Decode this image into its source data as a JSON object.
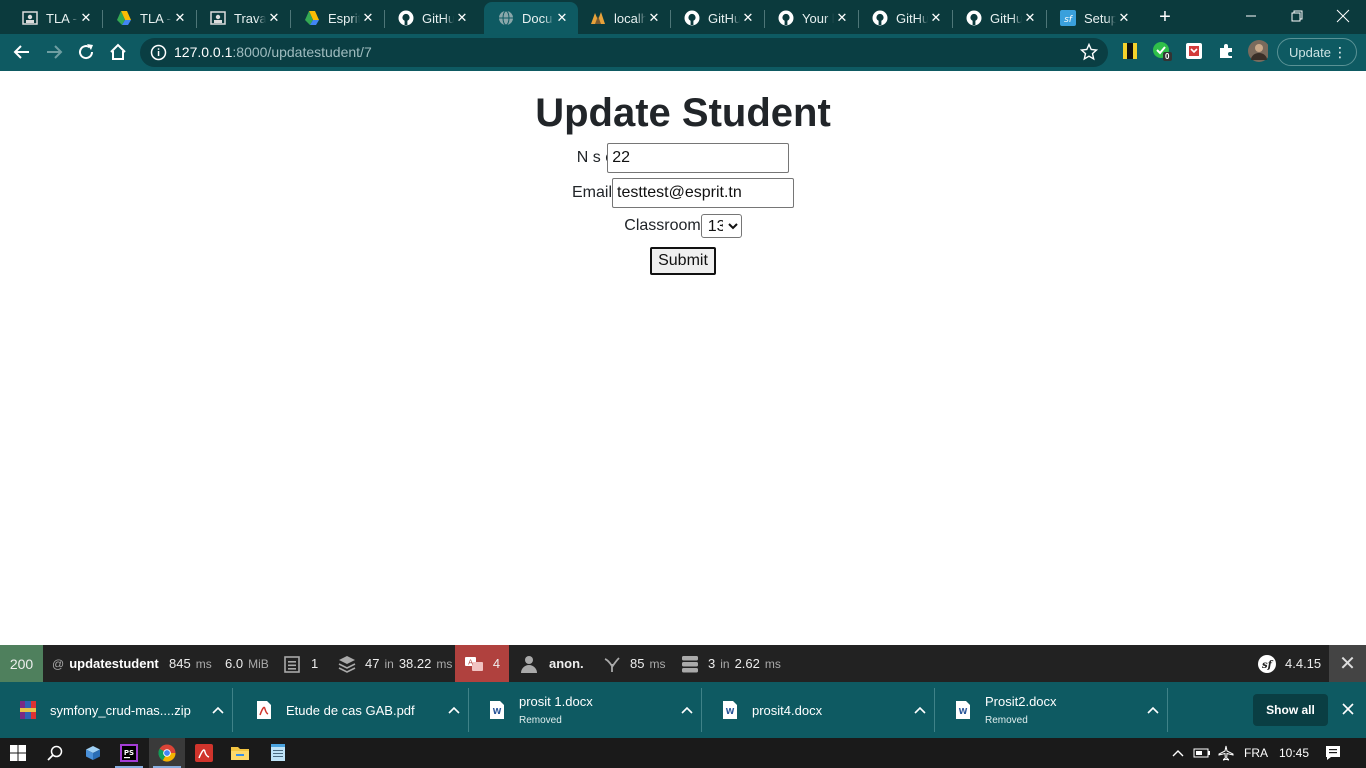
{
  "browser": {
    "tabs": [
      {
        "title": "TLA -",
        "icon": "person-board-icon"
      },
      {
        "title": "TLA -",
        "icon": "google-drive-icon"
      },
      {
        "title": "Travai",
        "icon": "person-board-icon"
      },
      {
        "title": "Esprit",
        "icon": "google-drive-icon"
      },
      {
        "title": "GitHu",
        "icon": "github-icon"
      },
      {
        "title": "Docu",
        "icon": "globe-icon",
        "active": true
      },
      {
        "title": "localh",
        "icon": "phpmyadmin-icon"
      },
      {
        "title": "GitHu",
        "icon": "github-icon"
      },
      {
        "title": "Your l",
        "icon": "github-icon"
      },
      {
        "title": "GitHu",
        "icon": "github-icon"
      },
      {
        "title": "GitHu",
        "icon": "github-icon"
      },
      {
        "title": "Setup",
        "icon": "symfony-icon"
      }
    ],
    "url_host": "127.0.0.1",
    "url_rest": ":8000/updatestudent/7",
    "update_label": "Update",
    "ext_badge": "0"
  },
  "form": {
    "title": "Update Student",
    "nsc_label": "N s c",
    "nsc_value": "22",
    "email_label": "Email",
    "email_value": "testtest@esprit.tn",
    "classroom_label": "Classroom",
    "classroom_value": "13",
    "submit_label": "Submit"
  },
  "profiler": {
    "status": "200",
    "route_prefix": "@",
    "route": "updatestudent",
    "time_value": "845",
    "time_unit": "ms",
    "memory_value": "6.0",
    "memory_unit": "MiB",
    "forms_count": "1",
    "templates_count": "47",
    "templates_in": "in",
    "templates_time": "38.22",
    "templates_unit": "ms",
    "errors_count": "4",
    "user": "anon.",
    "events_time": "85",
    "events_unit": "ms",
    "queries_count": "3",
    "queries_in": "in",
    "queries_time": "2.62",
    "queries_unit": "ms",
    "symfony_version": "4.4.15"
  },
  "downloads": [
    {
      "name": "symfony_crud-mas....zip",
      "sub": "",
      "icon": "zip-archive-icon"
    },
    {
      "name": "Etude de cas GAB.pdf",
      "sub": "",
      "icon": "pdf-icon"
    },
    {
      "name": "prosit 1.docx",
      "sub": "Removed",
      "icon": "word-doc-icon"
    },
    {
      "name": "prosit4.docx",
      "sub": "",
      "icon": "word-doc-icon"
    },
    {
      "name": "Prosit2.docx",
      "sub": "Removed",
      "icon": "word-doc-icon"
    }
  ],
  "show_all_label": "Show all",
  "taskbar": {
    "language": "FRA",
    "time": "10:45"
  },
  "colors": {
    "tab_strip": "#0b3a3d",
    "toolbar": "#0e5a62",
    "profiler_ok": "#4f805d",
    "profiler_error": "#b0413e"
  }
}
